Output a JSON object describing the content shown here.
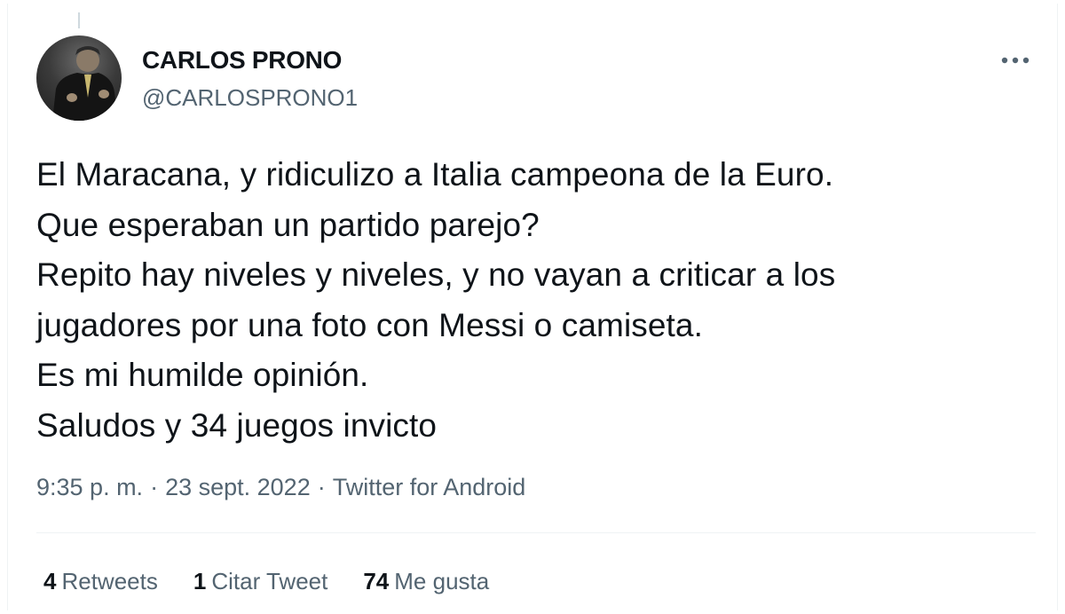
{
  "author": {
    "name": "CARLOS PRONO",
    "handle": "@CARLOSPRONO1",
    "avatar_icon": "profile-photo"
  },
  "more_icon": "more-horizontal-icon",
  "tweet": {
    "lines": [
      "El Maracana, y ridiculizo a Italia campeona de la Euro.",
      "Que esperaban un partido parejo?",
      "Repito hay niveles y niveles, y no vayan a criticar a los",
      "jugadores por una foto con Messi o camiseta.",
      "Es mi humilde opinión.",
      "Saludos y 34 juegos invicto"
    ]
  },
  "meta": {
    "time": "9:35 p. m.",
    "date": "23 sept. 2022",
    "source": "Twitter for Android",
    "separator": "·"
  },
  "stats": {
    "retweets_count": "4",
    "retweets_label": "Retweets",
    "quotes_count": "1",
    "quotes_label": "Citar Tweet",
    "likes_count": "74",
    "likes_label": "Me gusta"
  },
  "colors": {
    "primary_text": "#0f1419",
    "secondary_text": "#536471",
    "divider": "#eff3f4"
  }
}
